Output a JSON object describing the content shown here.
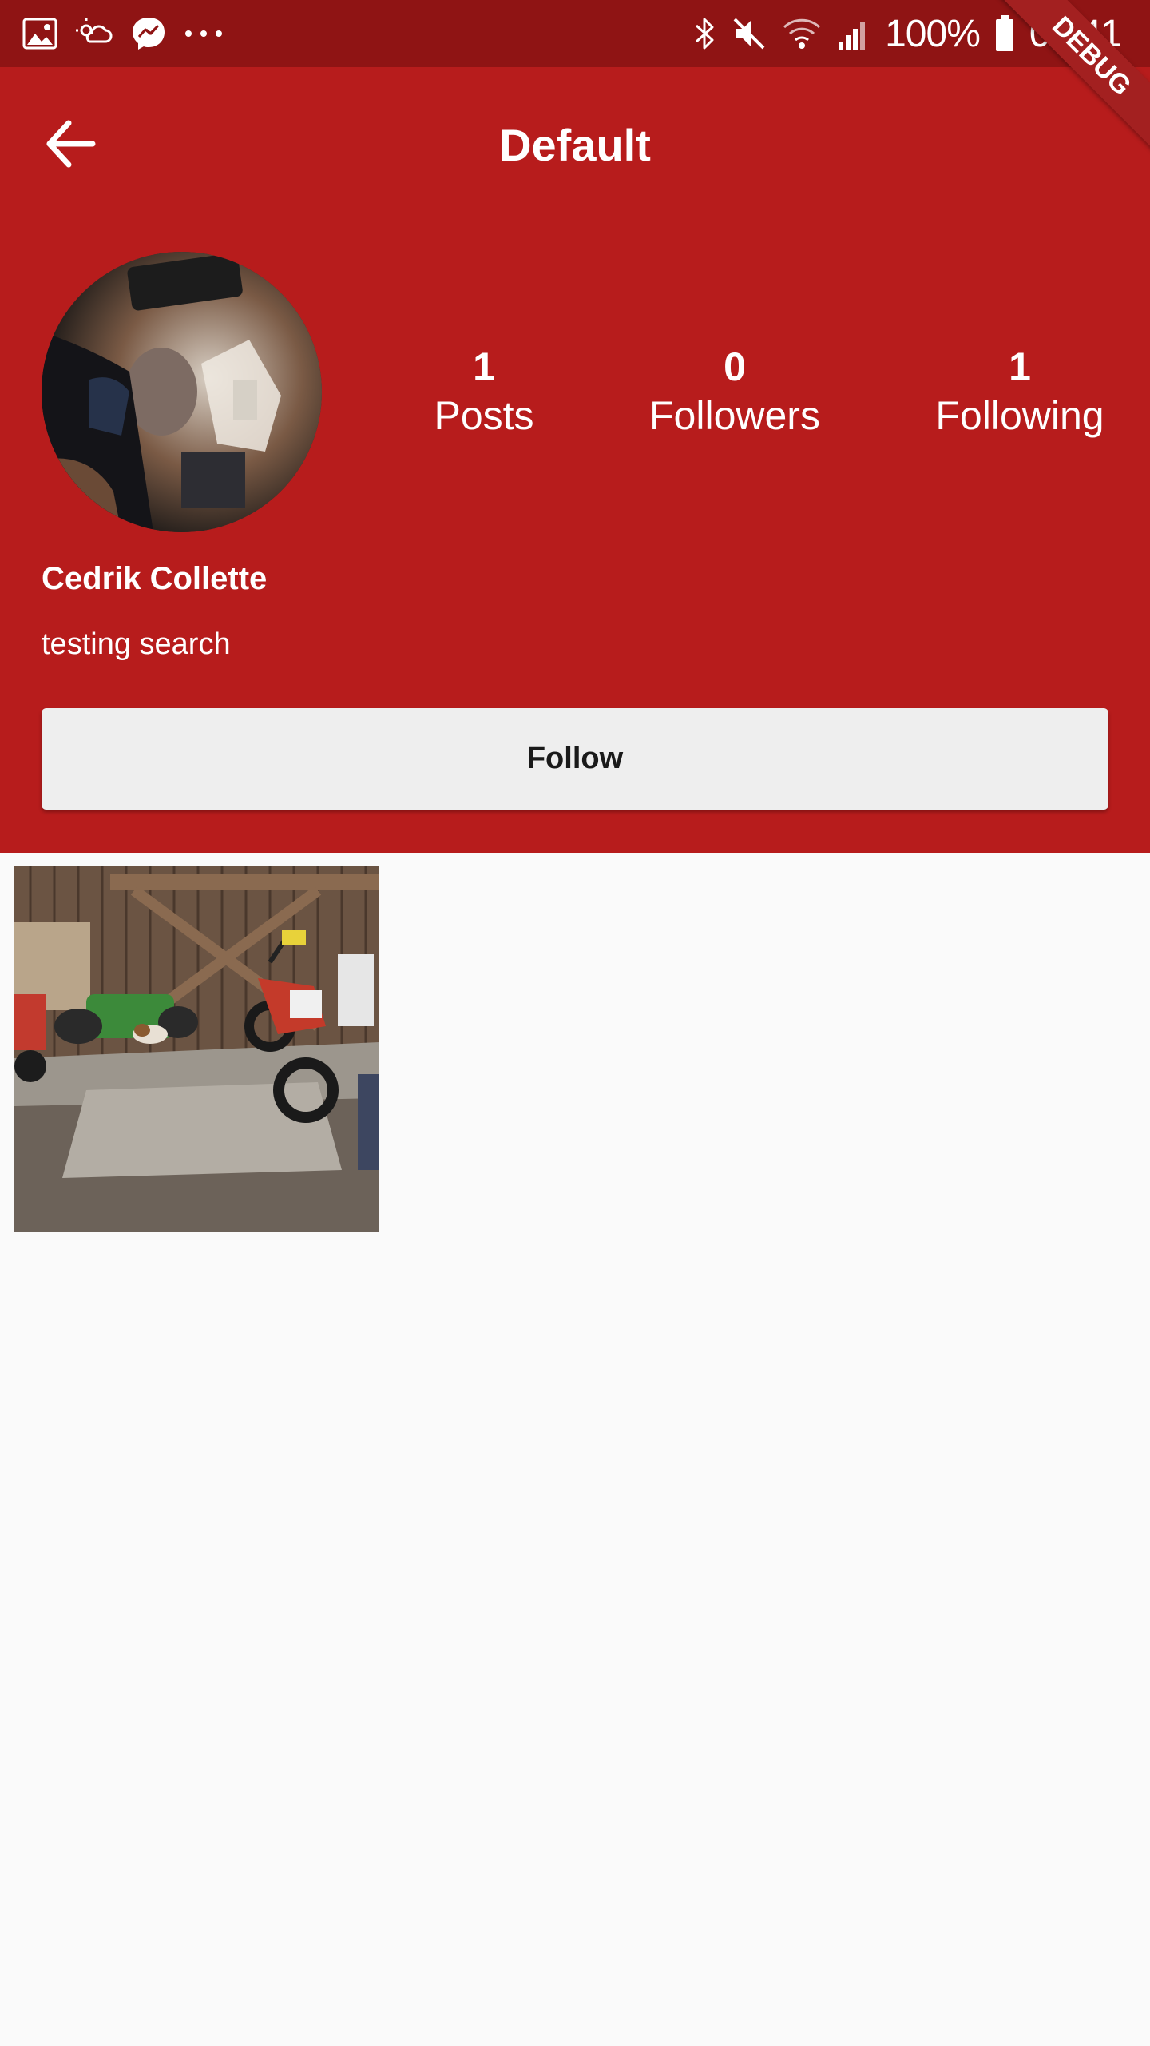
{
  "status_bar": {
    "left_icons": [
      "gallery-icon",
      "weather-icon",
      "messenger-icon",
      "more-dots-icon"
    ],
    "right_icons": [
      "bluetooth-icon",
      "mute-icon",
      "wifi-icon",
      "signal-icon",
      "battery-icon"
    ],
    "battery": "100%",
    "time": "09:41"
  },
  "debug_banner": "DEBUG",
  "app_bar": {
    "back_icon": "arrow-back-icon",
    "title": "Default"
  },
  "profile": {
    "display_name": "Cedrik Collette",
    "bio": "testing search",
    "stats": [
      {
        "value": "1",
        "label": "Posts"
      },
      {
        "value": "0",
        "label": "Followers"
      },
      {
        "value": "1",
        "label": "Following"
      }
    ],
    "follow_label": "Follow"
  },
  "posts": {
    "count_shown": 1
  },
  "colors": {
    "header_background": "#b71c1c",
    "status_bar_background": "#8f1414",
    "page_background": "#fafafa",
    "button_background": "#eeeeee"
  }
}
